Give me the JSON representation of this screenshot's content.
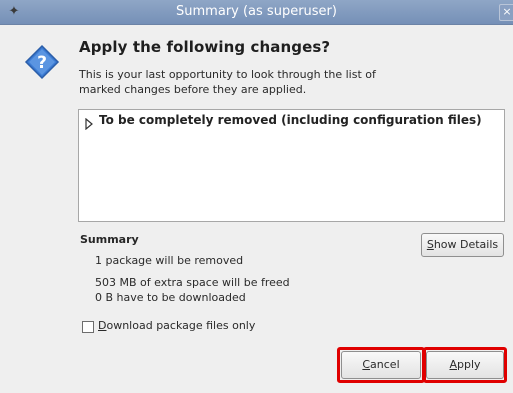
{
  "window": {
    "title": "Summary (as superuser)",
    "close_glyph": "×",
    "app_icon": "synaptic-icon"
  },
  "dialog": {
    "icon": "question-icon",
    "headline": "Apply the following changes?",
    "description": "This is your last opportunity to look through the list of marked changes before they are applied."
  },
  "changes": {
    "items": [
      {
        "label": "To be completely removed (including configuration files)",
        "expanded": false
      }
    ]
  },
  "summary": {
    "title": "Summary",
    "lines": [
      "1 package will be removed",
      "503 MB of extra space will be freed",
      "0  B have to be downloaded"
    ],
    "show_details_label": "Show Details"
  },
  "options": {
    "download_only_label": "Download package files only",
    "download_only_checked": false
  },
  "buttons": {
    "cancel_label": "Cancel",
    "apply_label": "Apply"
  },
  "colors": {
    "titlebar": "#7f99bf",
    "highlight": "#e00000",
    "question_icon": "#3b7ad3"
  }
}
